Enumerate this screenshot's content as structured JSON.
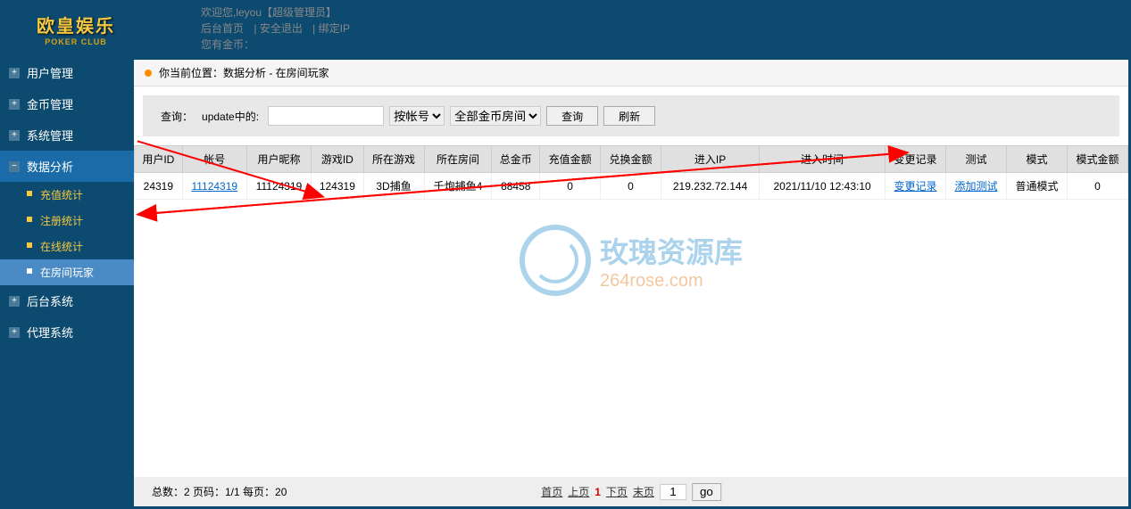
{
  "logo": {
    "main": "欧皇娱乐",
    "sub": "POKER CLUB"
  },
  "welcome": {
    "greeting": "欢迎您,",
    "username": "leyou",
    "role": "【超级管理员】",
    "links": {
      "home": "后台首页",
      "logout": "安全退出",
      "bindip": "绑定IP"
    },
    "gold_label": "您有金币：",
    "gold_value": ""
  },
  "sidebar": {
    "items": [
      {
        "label": "用户管理",
        "active": false
      },
      {
        "label": "金币管理",
        "active": false
      },
      {
        "label": "系统管理",
        "active": false
      },
      {
        "label": "数据分析",
        "active": true,
        "children": [
          {
            "label": "充值统计",
            "active": false
          },
          {
            "label": "注册统计",
            "active": false
          },
          {
            "label": "在线统计",
            "active": false
          },
          {
            "label": "在房间玩家",
            "active": true
          }
        ]
      },
      {
        "label": "后台系统",
        "active": false
      },
      {
        "label": "代理系统",
        "active": false
      }
    ]
  },
  "breadcrumb": {
    "prefix": "你当前位置：",
    "trail": "数据分析 - 在房间玩家"
  },
  "search": {
    "label1": "查询：",
    "label2": "update中的:",
    "input_value": "",
    "select1_options": [
      "按帐号"
    ],
    "select1_selected": "按帐号",
    "select2_options": [
      "全部金币房间"
    ],
    "select2_selected": "全部金币房间",
    "btn_search": "查询",
    "btn_refresh": "刷新"
  },
  "table": {
    "headers": [
      "用户ID",
      "帐号",
      "用户昵称",
      "游戏ID",
      "所在游戏",
      "所在房间",
      "总金币",
      "充值金额",
      "兑换金额",
      "进入IP",
      "进入时间",
      "变更记录",
      "测试",
      "模式",
      "模式金额"
    ],
    "rows": [
      {
        "user_id": "24319",
        "account": "11124319",
        "nickname": "11124319",
        "game_id": "124319",
        "game": "3D捕鱼",
        "room": "千炮捕鱼4",
        "gold": "88458",
        "recharge": "0",
        "exchange": "0",
        "ip": "219.232.72.144",
        "enter_time": "2021/11/10 12:43:10",
        "change_log": "变更记录",
        "test": "添加测试",
        "mode": "普通模式",
        "mode_amount": "0"
      }
    ]
  },
  "watermark": {
    "title": "玫瑰资源库",
    "url": "264rose.com"
  },
  "footer": {
    "info": "总数：2   页码：1/1   每页：20",
    "first": "首页",
    "prev": "上页",
    "current": "1",
    "next": "下页",
    "last": "末页",
    "page_input": "1",
    "go": "go"
  }
}
